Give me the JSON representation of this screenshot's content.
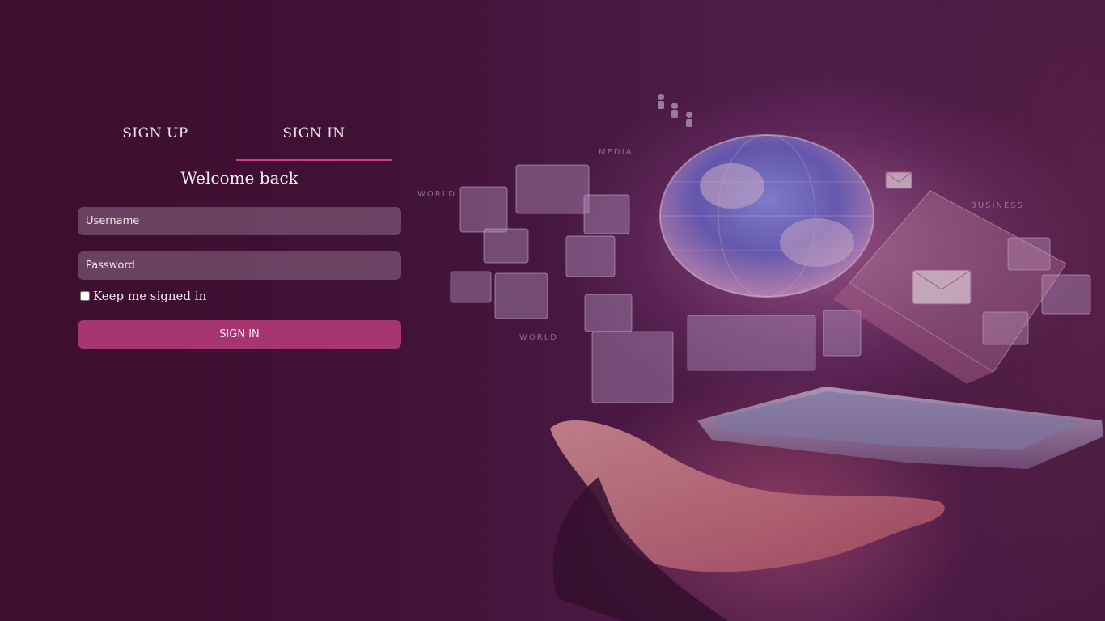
{
  "auth": {
    "tabs": [
      {
        "label": "SIGN UP"
      },
      {
        "label": "SIGN IN"
      }
    ],
    "active_tab": "SIGN IN",
    "welcome": "Welcome back",
    "username": {
      "placeholder": "Username",
      "value": ""
    },
    "password": {
      "placeholder": "Password",
      "value": ""
    },
    "keep_signed_in": {
      "label": "Keep me signed in",
      "checked": false
    },
    "submit_label": "SIGN IN"
  },
  "hero": {
    "labels": [
      "WORLD",
      "WORLD",
      "MEDIA",
      "BUSINESS"
    ]
  },
  "colors": {
    "background": "#3e1130",
    "accent": "#c93e86",
    "button": "#a7356f"
  }
}
